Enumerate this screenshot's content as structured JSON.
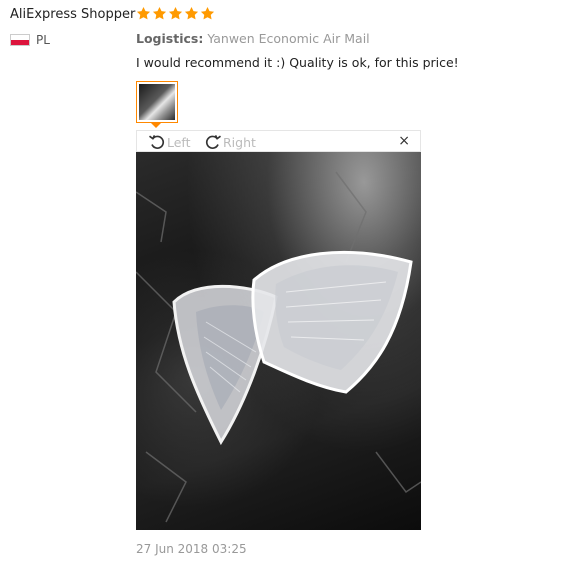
{
  "review": {
    "author": "AliExpress Shopper",
    "rating": 5,
    "country_code": "PL",
    "logistics_label": "Logistics:",
    "logistics_value": "Yanwen Economic Air Mail",
    "text": "I would recommend it :) Quality is ok, for this price!",
    "date": "27 Jun 2018 03:25"
  },
  "viewer": {
    "rotate_left_label": "Left",
    "rotate_right_label": "Right",
    "close_glyph": "×"
  },
  "colors": {
    "star": "#ff9a00",
    "thumb_border": "#ff8800",
    "flag_red": "#dc143c"
  }
}
